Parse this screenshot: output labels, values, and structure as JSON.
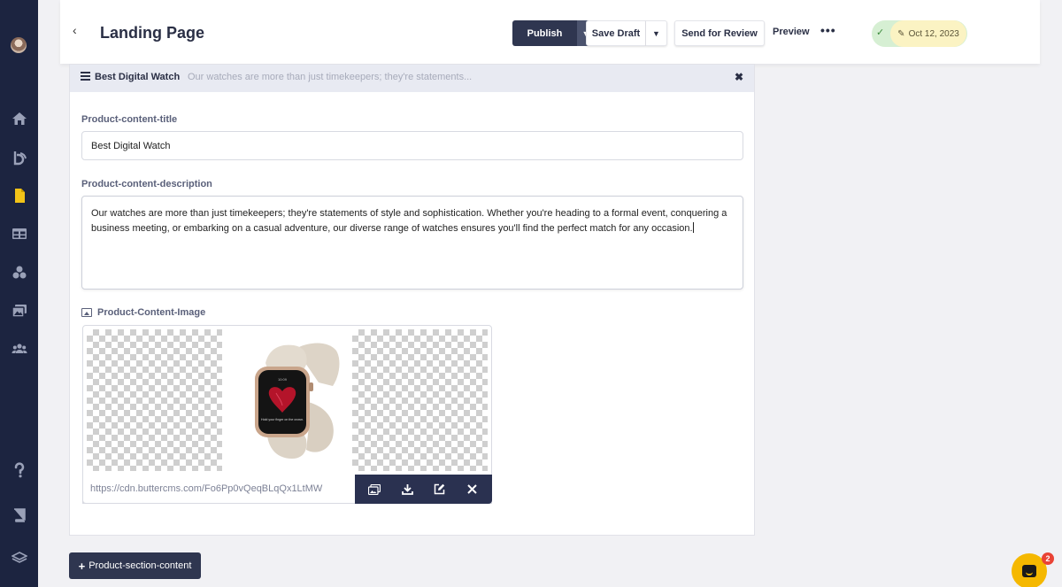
{
  "header": {
    "back_glyph": "‹",
    "title": "Landing Page",
    "publish_label": "Publish",
    "save_draft_label": "Save Draft",
    "send_review_label": "Send for Review",
    "preview_label": "Preview",
    "more_glyph": "•••",
    "status_check_glyph": "✓",
    "date_label": "Oct 12, 2023"
  },
  "sidebar": {
    "icons": [
      "avatar",
      "home-icon",
      "blog-icon",
      "page-icon",
      "table-icon",
      "collections-icon",
      "media-icon",
      "users-icon",
      "help-icon",
      "book-icon",
      "layers-icon"
    ]
  },
  "section": {
    "title": "Best Digital Watch",
    "preview_text": "Our watches are more than just timekeepers; they're statements...",
    "close_glyph": "✖",
    "fields": {
      "title_label": "Product-content-title",
      "title_value": "Best Digital Watch",
      "description_label": "Product-content-description",
      "description_value": "Our watches are more than just timekeepers; they're statements of style and sophistication. Whether you're heading to a formal event, conquering a business meeting, or embarking on a casual adventure, our diverse range of watches ensures you'll find the perfect match for any occasion.",
      "image_label": "Product-Content-Image",
      "image_url": "https://cdn.buttercms.com/Fo6Pp0vQeqBLqQx1LtMW",
      "watch_screen_text": "Hold your finger on the crown."
    }
  },
  "add_section_label": "Product-section-content",
  "chat": {
    "badge_count": "2"
  },
  "colors": {
    "sidebar": "#1c2440",
    "primary_button": "#2f3650",
    "status_green": "#d6efd3",
    "date_yellow": "#fbf3c3",
    "chat_yellow": "#f5b800",
    "badge_red": "#e94335"
  }
}
